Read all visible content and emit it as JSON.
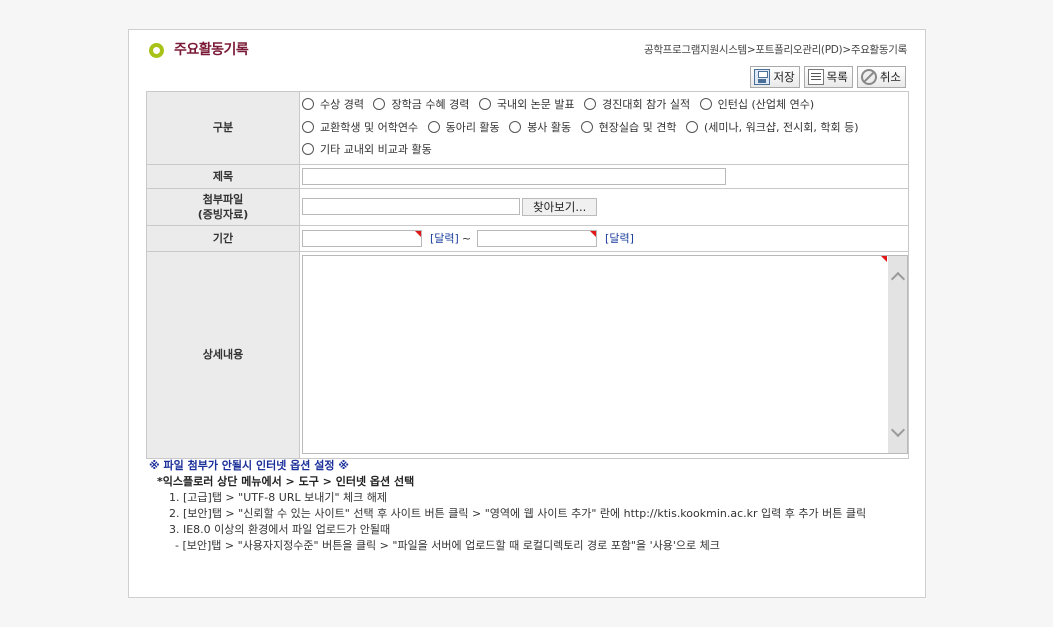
{
  "header": {
    "title": "주요활동기록",
    "breadcrumb": "공학프로그램지원시스템>포트폴리오관리(PD)>주요활동기록"
  },
  "toolbar": {
    "save_label": "저장",
    "list_label": "목록",
    "cancel_label": "취소"
  },
  "form": {
    "category_label": "구분",
    "categories": [
      "수상 경력",
      "장학금 수혜 경력",
      "국내외 논문 발표",
      "경진대회 참가 실적",
      "인턴십 (산업체 연수)",
      "교환학생 및 어학연수",
      "동아리 활동",
      "봉사 활동",
      "현장실습 및 견학",
      "(세미나, 워크샵, 전시회, 학회 등)",
      "기타 교내외 비교과 활동"
    ],
    "title_label": "제목",
    "attach_label_1": "첨부파일",
    "attach_label_2": "(증빙자료)",
    "browse_label": "찾아보기...",
    "period_label": "기간",
    "calendar_label": "[달력]",
    "period_separator": "~",
    "detail_label": "상세내용"
  },
  "notes": {
    "heading": "※ 파일 첨부가 안될시 인터넷 옵션 설정 ※",
    "subheading": "*익스플로러 상단 메뉴에서 > 도구 > 인터넷 옵션 선택",
    "step1": "1. [고급]탭 > \"UTF-8 URL 보내기\" 체크 해제",
    "step2": "2. [보안]탭 > \"신뢰할 수 있는 사이트\" 선택 후 사이트 버튼 클릭 > \"영역에 웹 사이트 추가\" 란에 http://ktis.kookmin.ac.kr 입력 후 추가 버튼 클릭",
    "step3": "3. IE8.0 이상의 환경에서 파일 업로드가 안될때",
    "step3_detail": "- [보안]탭 > \"사용자지정수준\" 버튼을 클릭 > \"파일을 서버에 업로드할 때 로컬디렉토리 경로 포함\"을 '사용'으로 체크"
  }
}
